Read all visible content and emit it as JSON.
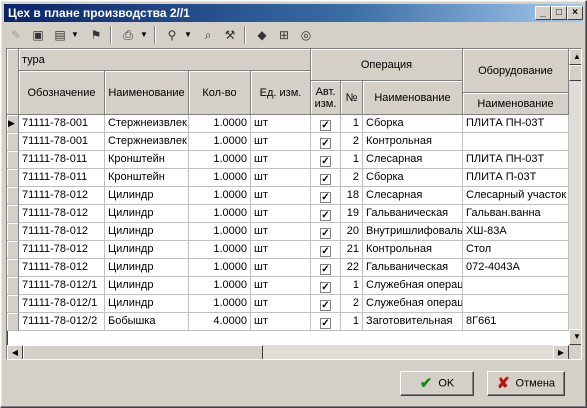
{
  "window": {
    "title": "Цех в плане производства 2//1",
    "controls": {
      "minimize": "_",
      "maximize": "□",
      "close": "×"
    }
  },
  "toolbar": {
    "icons": [
      "new-doc-icon",
      "save-icon",
      "document-icon",
      "bookmark-icon",
      "print-icon",
      "filter-icon",
      "find-icon",
      "tools-icon",
      "route-icon",
      "tree-icon",
      "refresh-icon"
    ]
  },
  "grid": {
    "group_headers": {
      "left": "тура",
      "operation": "Операция",
      "equipment": "Оборудование"
    },
    "columns": {
      "designation": "Обозначение",
      "name": "Наименование",
      "qty": "Кол-во",
      "unit": "Ед. изм.",
      "auto_unit_line1": "Авт.",
      "auto_unit_line2": "изм.",
      "num": "№",
      "op_name": "Наименование",
      "eq_name": "Наименование"
    },
    "rows": [
      {
        "designation": "71111-78-001",
        "name": "Стержнеизвлек",
        "qty": "1.0000",
        "unit": "шт",
        "auto": true,
        "num": "1",
        "op_name": "Сборка",
        "eq_name": "ПЛИТА ПН-03Т"
      },
      {
        "designation": "71111-78-001",
        "name": "Стержнеизвлек",
        "qty": "1.0000",
        "unit": "шт",
        "auto": true,
        "num": "2",
        "op_name": "Контрольная",
        "eq_name": ""
      },
      {
        "designation": "71111-78-011",
        "name": "Кронштейн",
        "qty": "1.0000",
        "unit": "шт",
        "auto": true,
        "num": "1",
        "op_name": "Слесарная",
        "eq_name": "ПЛИТА ПН-03Т"
      },
      {
        "designation": "71111-78-011",
        "name": "Кронштейн",
        "qty": "1.0000",
        "unit": "шт",
        "auto": true,
        "num": "2",
        "op_name": "Сборка",
        "eq_name": "ПЛИТА П-03Т"
      },
      {
        "designation": "71111-78-012",
        "name": "Цилиндр",
        "qty": "1.0000",
        "unit": "шт",
        "auto": true,
        "num": "18",
        "op_name": "Слесарная",
        "eq_name": "Слесарный участок"
      },
      {
        "designation": "71111-78-012",
        "name": "Цилиндр",
        "qty": "1.0000",
        "unit": "шт",
        "auto": true,
        "num": "19",
        "op_name": "Гальваническая",
        "eq_name": "Гальван.ванна"
      },
      {
        "designation": "71111-78-012",
        "name": "Цилиндр",
        "qty": "1.0000",
        "unit": "шт",
        "auto": true,
        "num": "20",
        "op_name": "Внутришлифовальная",
        "eq_name": "ХШ-83А"
      },
      {
        "designation": "71111-78-012",
        "name": "Цилиндр",
        "qty": "1.0000",
        "unit": "шт",
        "auto": true,
        "num": "21",
        "op_name": "Контрольная",
        "eq_name": "Стол"
      },
      {
        "designation": "71111-78-012",
        "name": "Цилиндр",
        "qty": "1.0000",
        "unit": "шт",
        "auto": true,
        "num": "22",
        "op_name": "Гальваническая",
        "eq_name": "072-4043А"
      },
      {
        "designation": "71111-78-012/1",
        "name": "Цилиндр",
        "qty": "1.0000",
        "unit": "шт",
        "auto": true,
        "num": "1",
        "op_name": "Служебная операция",
        "eq_name": ""
      },
      {
        "designation": "71111-78-012/1",
        "name": "Цилиндр",
        "qty": "1.0000",
        "unit": "шт",
        "auto": true,
        "num": "2",
        "op_name": "Служебная операция",
        "eq_name": ""
      },
      {
        "designation": "71111-78-012/2",
        "name": "Бобышка",
        "qty": "4.0000",
        "unit": "шт",
        "auto": true,
        "num": "1",
        "op_name": "Заготовительная",
        "eq_name": "8Г661"
      }
    ]
  },
  "buttons": {
    "ok": "OK",
    "cancel": "Отмена"
  },
  "colors": {
    "ok_icon": "#1a8a1a",
    "cancel_icon": "#c01010",
    "title_bg": "#0a246a"
  }
}
